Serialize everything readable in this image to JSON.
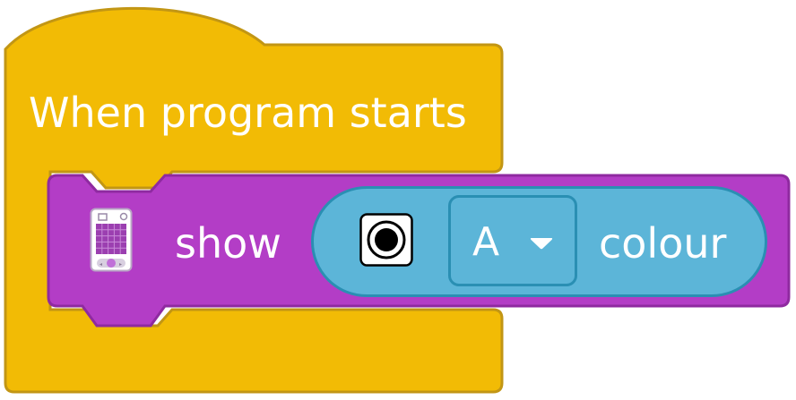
{
  "hat_block": {
    "label": "When program starts",
    "color": "#f2bb05",
    "border_color": "#c29614"
  },
  "stack_block": {
    "icon": "hub-light-matrix-icon",
    "label": "show",
    "color": "#b33dc6",
    "border_color": "#8f2aa0",
    "reporter": {
      "icon": "color-sensor-icon",
      "port": "A",
      "dropdown_icon": "caret-down-icon",
      "label": "colour",
      "color": "#5cb5d8",
      "border_color": "#2a8fb3"
    }
  }
}
